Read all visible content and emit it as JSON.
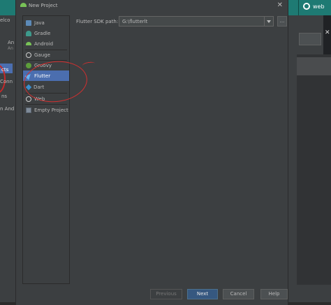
{
  "background": {
    "fragments": [
      "elco",
      "An",
      "An",
      "cts",
      "Conn",
      "ns",
      "n And"
    ],
    "web_label": "web"
  },
  "dialog": {
    "title": "New Project",
    "project_types": [
      {
        "label": "Java",
        "icon": "java-icon"
      },
      {
        "label": "Gradle",
        "icon": "gradle-icon"
      },
      {
        "label": "Android",
        "icon": "android-icon"
      },
      {
        "label": "Gauge",
        "icon": "gauge-icon"
      },
      {
        "label": "Groovy",
        "icon": "groovy-icon"
      },
      {
        "label": "Flutter",
        "icon": "flutter-icon",
        "selected": true
      },
      {
        "label": "Dart",
        "icon": "dart-icon"
      },
      {
        "label": "Web",
        "icon": "web-icon"
      },
      {
        "label": "Empty Project",
        "icon": "empty-project-icon"
      }
    ],
    "sdk": {
      "label": "Flutter SDK path:",
      "value": "G:\\flutterlt",
      "browse_label": "..."
    },
    "buttons": {
      "previous": "Previous",
      "next": "Next",
      "cancel": "Cancel",
      "help": "Help"
    }
  },
  "colors": {
    "accent": "#4b6eaf",
    "primary_button": "#365880",
    "annotation": "#d32f2f",
    "taskbar": "#1e7a73"
  }
}
